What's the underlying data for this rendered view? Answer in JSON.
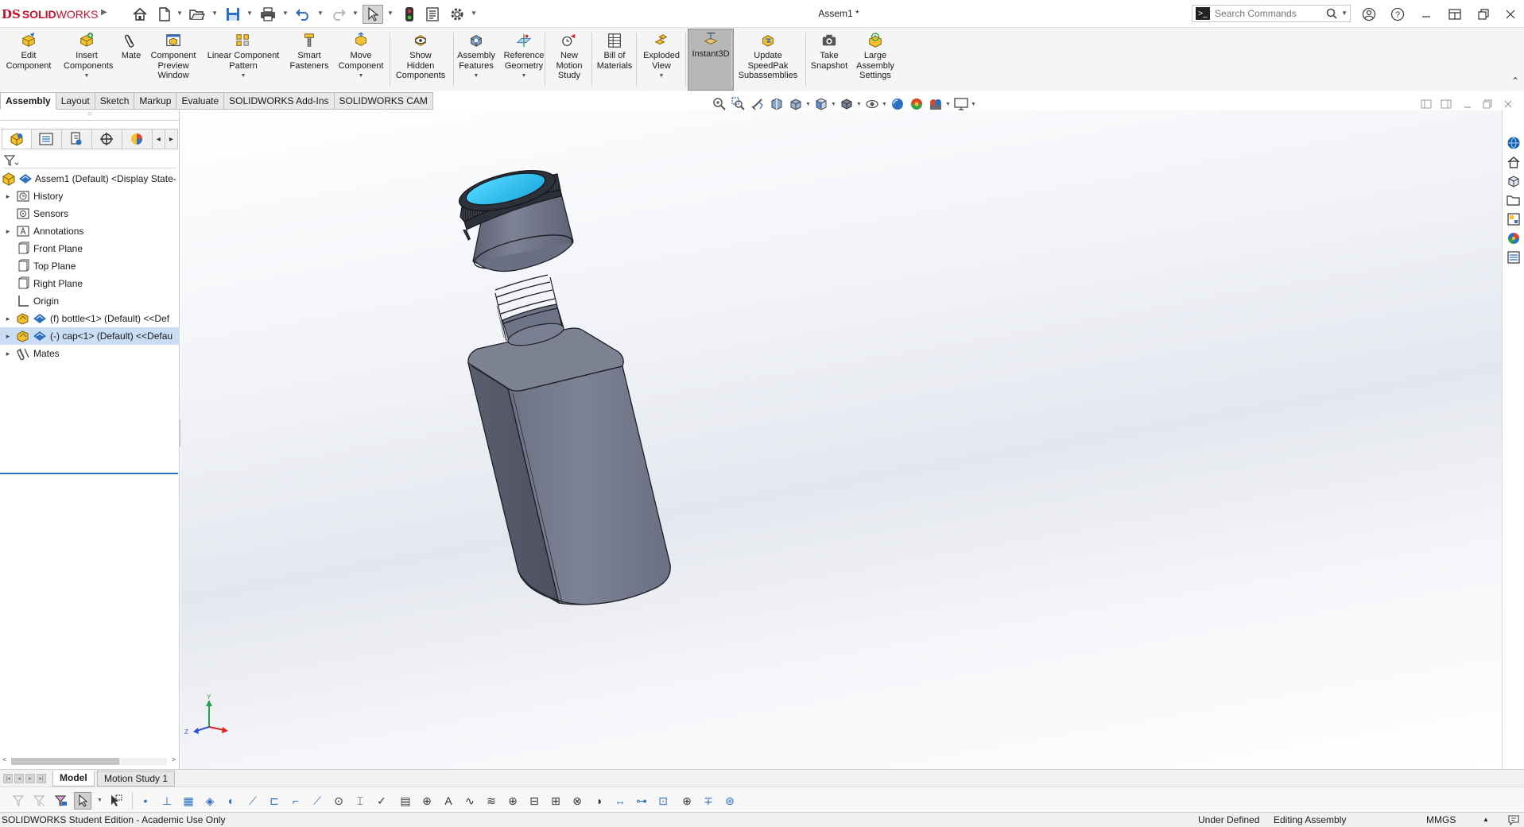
{
  "app": {
    "logo_ds": "DS",
    "logo_solid": "SOLID",
    "logo_works": "WORKS",
    "document_title": "Assem1 *",
    "search_placeholder": "Search Commands"
  },
  "quick_access": [
    {
      "icon": "home-icon"
    },
    {
      "icon": "new-document-icon"
    },
    {
      "icon": "open-folder-icon"
    },
    {
      "icon": "save-icon"
    },
    {
      "icon": "print-icon"
    },
    {
      "icon": "undo-icon"
    },
    {
      "icon": "redo-icon"
    },
    {
      "icon": "select-arrow-icon"
    },
    {
      "icon": "traffic-light-icon"
    },
    {
      "icon": "file-properties-icon"
    },
    {
      "icon": "options-gear-icon"
    }
  ],
  "ribbon": {
    "commands": [
      {
        "label": "Edit Component",
        "lines": [
          "Edit",
          "Component"
        ],
        "icon": "edit-component-icon"
      },
      {
        "label": "Insert Components",
        "lines": [
          "Insert",
          "Components"
        ],
        "icon": "insert-components-icon"
      },
      {
        "label": "Mate",
        "lines": [
          "Mate"
        ],
        "icon": "mate-paperclip-icon"
      },
      {
        "label": "Component Preview Window",
        "lines": [
          "Component",
          "Preview",
          "Window"
        ],
        "icon": "preview-window-icon"
      },
      {
        "label": "Linear Component Pattern",
        "lines": [
          "Linear Component",
          "Pattern"
        ],
        "icon": "linear-pattern-icon"
      },
      {
        "label": "Smart Fasteners",
        "lines": [
          "Smart",
          "Fasteners"
        ],
        "icon": "smart-fasteners-icon"
      },
      {
        "label": "Move Component",
        "lines": [
          "Move",
          "Component"
        ],
        "icon": "move-component-icon"
      },
      {
        "label": "Show Hidden Components",
        "lines": [
          "Show",
          "Hidden",
          "Components"
        ],
        "icon": "show-hidden-icon"
      },
      {
        "label": "Assembly Features",
        "lines": [
          "Assembly",
          "Features"
        ],
        "icon": "assembly-features-icon"
      },
      {
        "label": "Reference Geometry",
        "lines": [
          "Reference",
          "Geometry"
        ],
        "icon": "reference-geometry-icon"
      },
      {
        "label": "New Motion Study",
        "lines": [
          "New",
          "Motion",
          "Study"
        ],
        "icon": "motion-study-icon"
      },
      {
        "label": "Bill of Materials",
        "lines": [
          "Bill of",
          "Materials"
        ],
        "icon": "bill-of-materials-icon"
      },
      {
        "label": "Exploded View",
        "lines": [
          "Exploded",
          "View"
        ],
        "icon": "exploded-view-icon"
      },
      {
        "label": "Instant3D",
        "lines": [
          "Instant3D"
        ],
        "icon": "instant3d-icon"
      },
      {
        "label": "Update SpeedPak Subassemblies",
        "lines": [
          "Update",
          "SpeedPak",
          "Subassemblies"
        ],
        "icon": "speedpak-icon"
      },
      {
        "label": "Take Snapshot",
        "lines": [
          "Take",
          "Snapshot"
        ],
        "icon": "camera-icon"
      },
      {
        "label": "Large Assembly Settings",
        "lines": [
          "Large",
          "Assembly",
          "Settings"
        ],
        "icon": "large-assembly-icon"
      }
    ]
  },
  "tabs": [
    "Assembly",
    "Layout",
    "Sketch",
    "Markup",
    "Evaluate",
    "SOLIDWORKS Add-Ins",
    "SOLIDWORKS CAM"
  ],
  "active_tab": "Assembly",
  "tree": {
    "root": "Assem1 (Default) <Display State-",
    "items": [
      {
        "label": "History",
        "expandable": true,
        "icon": "history-folder-icon"
      },
      {
        "label": "Sensors",
        "expandable": false,
        "icon": "sensors-folder-icon"
      },
      {
        "label": "Annotations",
        "expandable": true,
        "icon": "annotations-icon"
      },
      {
        "label": "Front Plane",
        "expandable": false,
        "icon": "plane-icon"
      },
      {
        "label": "Top Plane",
        "expandable": false,
        "icon": "plane-icon"
      },
      {
        "label": "Right Plane",
        "expandable": false,
        "icon": "plane-icon"
      },
      {
        "label": "Origin",
        "expandable": false,
        "icon": "origin-icon"
      },
      {
        "label": "(f) bottle<1> (Default) <<Def",
        "expandable": true,
        "icon": "part-component-icon"
      },
      {
        "label": "(-) cap<1> (Default) <<Defau",
        "expandable": true,
        "icon": "part-component-icon",
        "selected": true
      },
      {
        "label": "Mates",
        "expandable": true,
        "icon": "mates-icon"
      }
    ]
  },
  "bottom_tabs": [
    "Model",
    "Motion Study 1"
  ],
  "status": {
    "edition": "SOLIDWORKS Student Edition - Academic Use Only",
    "definition": "Under Defined",
    "mode": "Editing Assembly",
    "units": "MMGS",
    "units_arrow": "▲"
  },
  "triad": {
    "y_label": "Y",
    "z_label": "Z"
  },
  "colors": {
    "brand": "#c8102e",
    "selection": "#c9def5",
    "cap_top": "#30c8f0",
    "body": "#7a7f92"
  }
}
